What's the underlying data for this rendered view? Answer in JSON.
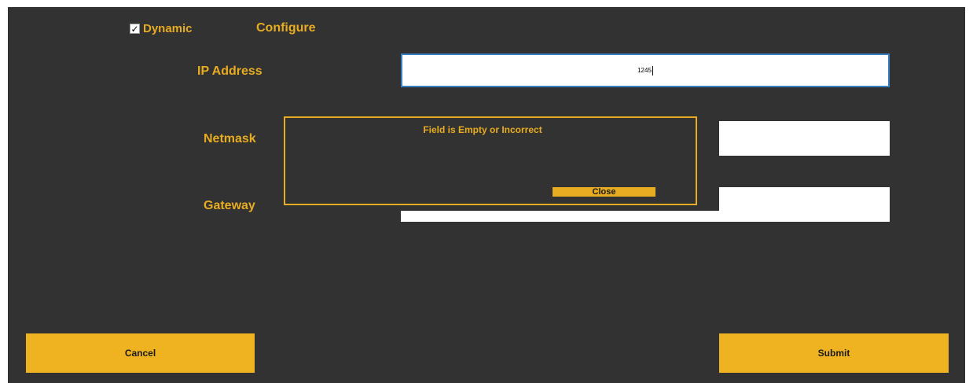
{
  "header": {
    "dynamic_label": "Dynamic",
    "dynamic_checked": true,
    "check_glyph": "✓",
    "configure_label": "Configure"
  },
  "form": {
    "ip_label": "IP Address",
    "ip_value": "1245",
    "netmask_label": "Netmask",
    "netmask_value": "",
    "gateway_label": "Gateway",
    "gateway_value": ""
  },
  "dialog": {
    "message": "Field is Empty or Incorrect",
    "close_label": "Close"
  },
  "footer": {
    "cancel_label": "Cancel",
    "submit_label": "Submit"
  },
  "colors": {
    "background": "#323232",
    "accent": "#e8ac22",
    "button": "#efb322",
    "input_focus_border": "#3a7fc1"
  }
}
